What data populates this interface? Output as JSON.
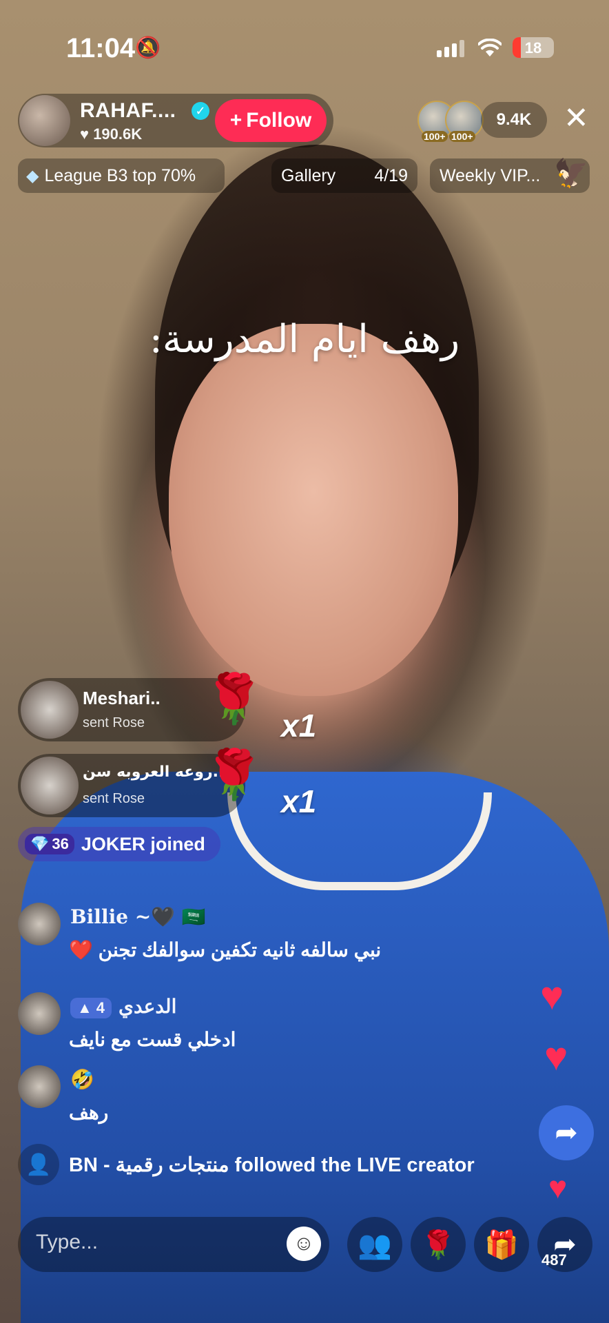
{
  "status_bar": {
    "time": "11:04",
    "battery": "18"
  },
  "host": {
    "name": "RAHAF....",
    "likes": "190.6K",
    "follow_label": "Follow",
    "follow_prefix": "+"
  },
  "viewers": {
    "count": "9.4K",
    "badge_1": "100+",
    "badge_2": "100+"
  },
  "pills": {
    "league": "League B3 top 70%",
    "gallery": "Gallery",
    "gallery_count": "4/19",
    "weekly": "Weekly VIP..."
  },
  "caption": "رهف ايام المدرسة:",
  "gifts": [
    {
      "name": "Meshari..",
      "action": "sent Rose",
      "count": "x1"
    },
    {
      "name": "روعه العروبه سن...",
      "action": "sent Rose",
      "count": "x1"
    }
  ],
  "joined": {
    "level": "36",
    "text": "JOKER joined"
  },
  "comments": [
    {
      "user": "Billie ~🖤 🇸🇦",
      "text": "نبي سالفه ثانيه تكفين سوالفك تجنن ❤️"
    },
    {
      "user": "الدعدي",
      "level": "4",
      "text": "ادخلي قست مع نايف"
    },
    {
      "user": "🤣",
      "text": "رهف"
    }
  ],
  "follow_event": {
    "text": "BN - منتجات رقمية followed the LIVE creator"
  },
  "bottom_bar": {
    "placeholder": "Type...",
    "share_count": "487"
  },
  "colors": {
    "follow": "#fe2c55",
    "share_fab": "#3d6fe0",
    "heart": "#ff2d55",
    "verified": "#20d5ec"
  }
}
